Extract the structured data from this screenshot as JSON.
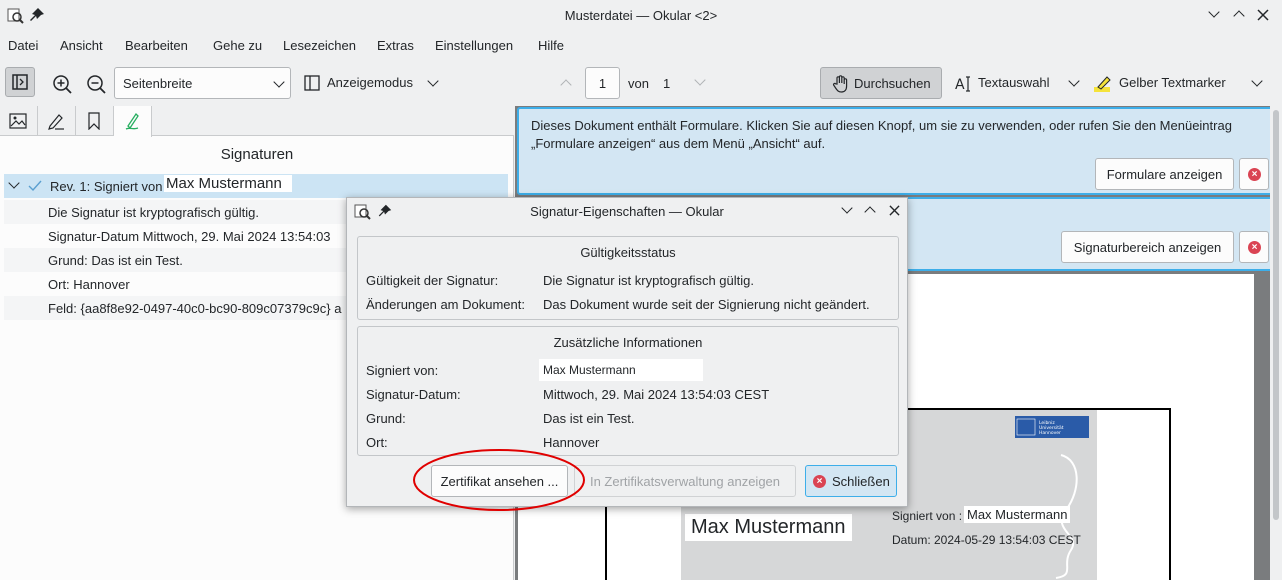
{
  "window": {
    "title": "Musterdatei — Okular <2>"
  },
  "menu": [
    "Datei",
    "Ansicht",
    "Bearbeiten",
    "Gehe zu",
    "Lesezeichen",
    "Extras",
    "Einstellungen",
    "Hilfe"
  ],
  "toolbar": {
    "zoom_mode": "Seitenbreite",
    "view_mode_label": "Anzeigemodus",
    "page_current": "1",
    "page_of": "von",
    "page_total": "1",
    "browse_label": "Durchsuchen",
    "text_select_label": "Textauswahl",
    "highlighter_label": "Gelber Textmarker"
  },
  "sidebar": {
    "title": "Signaturen",
    "revision_label": "Rev. 1: Signiert von",
    "revision_signer": "Max Mustermann",
    "details": [
      "Die Signatur ist kryptografisch gültig.",
      "Signatur-Datum Mittwoch, 29. Mai 2024 13:54:03",
      "Grund: Das ist ein Test.",
      "Ort: Hannover",
      "Feld: {aa8f8e92-0497-40c0-bc90-809c07379c9c} a"
    ]
  },
  "banners": {
    "forms_text": "Dieses Dokument enthält Formulare. Klicken Sie auf diesen Knopf, um sie zu verwenden, oder rufen Sie den Menüeintrag „Formulare anzeigen“ aus dem Menü „Ansicht“ auf.",
    "forms_button": "Formulare anzeigen",
    "signature_button": "Signaturbereich anzeigen"
  },
  "document": {
    "signer_big": "Max Mustermann",
    "signed_by_label": "Signiert von :",
    "signed_by_value": "Max Mustermann",
    "date_line": "Datum: 2024-05-29 13:54:03 CEST",
    "logo_text": "Leibniz Universität Hannover"
  },
  "dialog": {
    "title": "Signatur-Eigenschaften — Okular",
    "validity_group": "Gültigkeitsstatus",
    "validity_label": "Gültigkeit der Signatur:",
    "validity_value": "Die Signatur ist kryptografisch gültig.",
    "changes_label": "Änderungen am Dokument:",
    "changes_value": "Das Dokument wurde seit der Signierung nicht geändert.",
    "info_group": "Zusätzliche Informationen",
    "signed_by_label": "Signiert von:",
    "signed_by_value": "Max Mustermann",
    "date_label": "Signatur-Datum:",
    "date_value": "Mittwoch, 29. Mai 2024 13:54:03 CEST",
    "reason_label": "Grund:",
    "reason_value": "Das ist ein Test.",
    "location_label": "Ort:",
    "location_value": "Hannover",
    "btn_cert": "Zertifikat ansehen ...",
    "btn_cert_mgmt": "In Zertifikatsverwaltung anzeigen",
    "btn_close": "Schließen"
  },
  "colors": {
    "accent": "#3daee9",
    "banner_bg": "#d3e6f3",
    "selection": "#cce4f4",
    "annotation_red": "#e00000",
    "close_red": "#da4453"
  }
}
